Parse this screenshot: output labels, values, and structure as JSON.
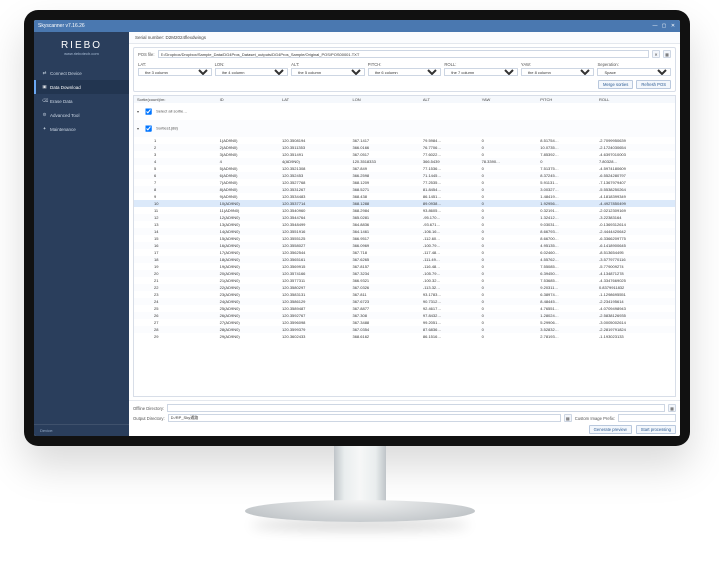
{
  "window": {
    "title": "Skyscanner v7.16.26",
    "min": "—",
    "max": "▢",
    "close": "✕"
  },
  "brand": {
    "name": "RIEBO",
    "site": "www.riebotech.com"
  },
  "sidebar": {
    "items": [
      {
        "icon": "⇄",
        "label": "Connect Device"
      },
      {
        "icon": "▣",
        "label": "Data Download"
      },
      {
        "icon": "⌫",
        "label": "Erase Data"
      },
      {
        "icon": "⚙",
        "label": "Advanced Tool"
      },
      {
        "icon": "✦",
        "label": "Maintenance"
      }
    ],
    "footer": "Device:"
  },
  "serial": {
    "label": "Serial number:",
    "value": "D2M2024flexdwings"
  },
  "pos": {
    "group_label": "POS",
    "file_label": "POS file:",
    "file_value": "E:/Dropbox/Dropbox/Sample_Data/DG4Pros_Dataset_outputs/DG4Pros_Sample/Original_POS/POS00001.TXT",
    "clear_icon": "✕",
    "browse_icon": "▦",
    "columns": [
      {
        "name": "LAT:",
        "value": "the 3 column"
      },
      {
        "name": "LON:",
        "value": "the 4 column"
      },
      {
        "name": "ALT:",
        "value": "the 5 column"
      },
      {
        "name": "PITCH:",
        "value": "the 6 column"
      },
      {
        "name": "ROLL:",
        "value": "the 7 column"
      },
      {
        "name": "YAW:",
        "value": "the 8 column"
      },
      {
        "name": "Seperation:",
        "value": "Space"
      }
    ],
    "merge_btn": "Merge sorties",
    "refresh_btn": "Refresh POS"
  },
  "table": {
    "count_label": "Sortie(count)/m:",
    "headers": [
      "ID",
      "LAT",
      "LON",
      "ALT",
      "YAW",
      "PITCH",
      "ROLL"
    ],
    "tree_root": "Select all sortie…",
    "tree_child": "Sorties1(88)",
    "rows": [
      [
        "1",
        "1(AD9N0)",
        "120.3508194",
        "367.1417",
        "79.5984…",
        "0",
        "8.51754…",
        "-2.7099950639"
      ],
      [
        "2",
        "2(AD9N0)",
        "120.3511353",
        "366.0166",
        "76.7706…",
        "0",
        "10.0735…",
        "-2.1724030654"
      ],
      [
        "3",
        "3(AD9N0)",
        "120.351491",
        "367.0517",
        "77.6022…",
        "0",
        "7.85392…",
        "-4.6397010003"
      ],
      [
        "4",
        "4",
        "4(AD9N0)",
        "120.3518333",
        "366.5439",
        "78.3390…",
        "0",
        "7.80328…",
        "-3.0397548034"
      ],
      [
        "5",
        "5(AD9N0)",
        "120.3521308",
        "367.849",
        "77.1536…",
        "0",
        "7.51375…",
        "-4.5974180609"
      ],
      [
        "6",
        "6(AD9N0)",
        "120.352453",
        "366.2598",
        "71.1445…",
        "0",
        "8.37245…",
        "-6.5524280797"
      ],
      [
        "7",
        "7(AD9N0)",
        "120.3527768",
        "368.1209",
        "77.2535…",
        "0",
        "5.91131…",
        "-7.1367979407"
      ],
      [
        "8",
        "8(AD9N0)",
        "120.3531267",
        "368.5271",
        "81.8454…",
        "0",
        "3.00327…",
        "-5.5538250264"
      ],
      [
        "9",
        "9(AD9N0)",
        "120.3534483",
        "368.438",
        "86.1451…",
        "0",
        "1.48419…",
        "-4.1818399349"
      ],
      [
        "10",
        "10(AD9N0)",
        "120.3537714",
        "368.1288",
        "89.0938…",
        "0",
        "1.92956…",
        "-4.4927850499"
      ],
      [
        "11",
        "11(AD9N0)",
        "120.3540960",
        "368.2984",
        "93.8605…",
        "0",
        "0.32191…",
        "-2.0212309169"
      ],
      [
        "12",
        "12(AD9N0)",
        "120.3544764",
        "365.0281",
        "-95.170…",
        "0",
        "1.32412…",
        "-3.22383164"
      ],
      [
        "13",
        "13(AD9N0)",
        "120.3548499",
        "364.8836",
        "-93.671…",
        "0",
        "9.03031…",
        "-0.1369312614"
      ],
      [
        "14",
        "14(AD9N0)",
        "120.3551916",
        "364.1461",
        "-106.16…",
        "0",
        "8.66793…",
        "-2.4444420642"
      ],
      [
        "15",
        "15(AD9N0)",
        "120.3555125",
        "366.9517",
        "-112.60…",
        "0",
        "8.66700…",
        "-6.3366209775"
      ],
      [
        "16",
        "16(AD9N0)",
        "120.3558027",
        "366.0969",
        "-100.79…",
        "0",
        "4.95135…",
        "-6.1418900645"
      ],
      [
        "17",
        "17(AD9N0)",
        "120.3562544",
        "367.718",
        "-117.48…",
        "0",
        "6.02460…",
        "-8.513654495"
      ],
      [
        "18",
        "18(AD9N0)",
        "120.3565161",
        "367.6265",
        "-111.49…",
        "0",
        "4.55762…",
        "-3.5779770116"
      ],
      [
        "19",
        "19(AD9N0)",
        "120.3569915",
        "367.8157",
        "-116.48…",
        "0",
        "7.55085…",
        "-5.779009274"
      ],
      [
        "20",
        "20(AD9N0)",
        "120.3574166",
        "367.3234",
        "-105.79…",
        "0",
        "6.39450…",
        "-4.134871278"
      ],
      [
        "21",
        "21(AD9N0)",
        "120.3577311",
        "366.9321",
        "-100.32…",
        "0",
        "7.53685…",
        "-4.3347669025"
      ],
      [
        "22",
        "22(AD9N0)",
        "120.3580297",
        "367.0326",
        "-113.32…",
        "0",
        "9.20311…",
        "0.8379911832"
      ],
      [
        "23",
        "23(AD9N0)",
        "120.3583131",
        "367.811",
        "93.1783…",
        "0",
        "6.38974…",
        "-1.1298695551"
      ],
      [
        "24",
        "24(AD9N0)",
        "120.3586129",
        "367.6723",
        "90.7312…",
        "0",
        "8.48445…",
        "-2.234195614"
      ],
      [
        "25",
        "25(AD9N0)",
        "120.3589487",
        "367.8877",
        "92.4617…",
        "0",
        "4.76551…",
        "-4.0709498943"
      ],
      [
        "26",
        "26(AD9N0)",
        "120.3592767",
        "367.308",
        "97.8432…",
        "0",
        "1.28024…",
        "-2.5838126935"
      ],
      [
        "27",
        "27(AD9N0)",
        "120.3596098",
        "367.3488",
        "99.2051…",
        "0",
        "5.29906…",
        "-3.0005002614"
      ],
      [
        "28",
        "28(AD9N0)",
        "120.3599379",
        "367.0354",
        "87.6836…",
        "0",
        "3.52832…",
        "-2.2819791824"
      ],
      [
        "29",
        "29(AD9N0)",
        "120.3602433",
        "368.6162",
        "86.1516…",
        "0",
        "2.78193…",
        "-1.193023133"
      ]
    ],
    "selected_index": 9
  },
  "bottom": {
    "offline_label": "Offline Directory:",
    "offline_value": "",
    "offline_browse": "▦",
    "output_label": "Output Directory:",
    "output_value": "D:/RP_Sky通路",
    "output_browse": "▦",
    "prefix_label": "Custom Image Prefix:",
    "prefix_value": "",
    "preview_btn": "Generate preview",
    "start_btn": "Start processing"
  }
}
